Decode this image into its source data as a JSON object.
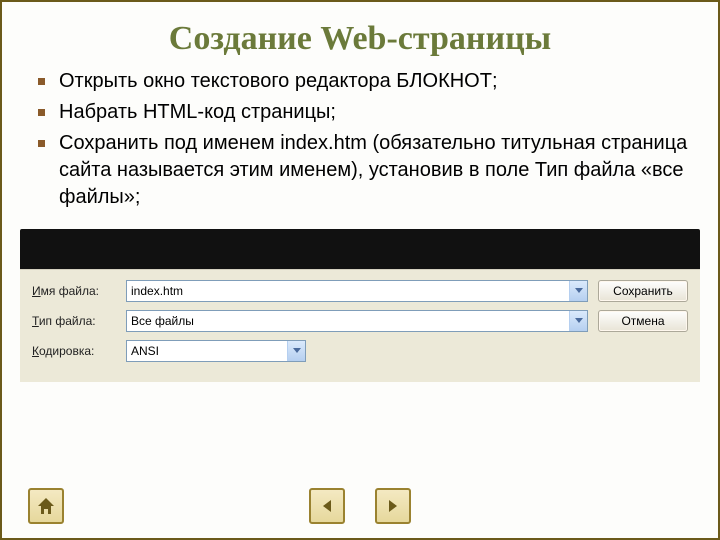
{
  "title": "Создание Web-страницы",
  "bullets": [
    "Открыть окно текстового редактора БЛОКНОТ;",
    "Набрать HTML-код страницы;",
    "Сохранить под именем index.htm (обязательно титульная страница сайта называется этим именем), установив в поле Тип файла «все файлы»;"
  ],
  "dialog": {
    "filename_label": "Имя файла:",
    "filename_underline": "И",
    "filename_rest": "мя файла:",
    "filename_value": "index.htm",
    "filetype_label": "Тип файла:",
    "filetype_underline": "Т",
    "filetype_rest": "ип файла:",
    "filetype_value": "Все файлы",
    "encoding_label": "Кодировка:",
    "encoding_underline": "К",
    "encoding_rest": "одировка:",
    "encoding_value": "ANSI",
    "save_button": "Сохранить",
    "cancel_button": "Отмена"
  },
  "nav": {
    "home": "home-icon",
    "prev": "arrow-left-icon",
    "next": "arrow-right-icon"
  }
}
